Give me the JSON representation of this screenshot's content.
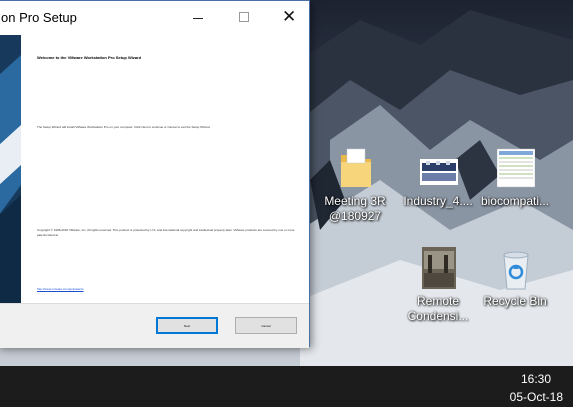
{
  "window": {
    "title": "on Pro Setup",
    "heading": "Welcome to the VMware Workstation Pro Setup Wizard",
    "description": "The Setup Wizard will install VMware Workstation Pro on your computer. Click Next to continue or Cancel to exit the Setup Wizard.",
    "copyright": "Copyright © 1998-2018 VMware, Inc. All rights reserved. This product is protected by U.S. and international copyright and intellectual property laws. VMware products are covered by one or more patents listed at",
    "link": "http://www.vmware.com/go/patents",
    "next_label": "Next",
    "cancel_label": "Cancel",
    "close_glyph": "✕"
  },
  "desktop": {
    "icons": [
      {
        "label": "Meeting 3R @180927",
        "icon": "folder-icon"
      },
      {
        "label": "Industry_4....",
        "icon": "image-thumbnail-icon"
      },
      {
        "label": "biocompati...",
        "icon": "spreadsheet-thumbnail-icon"
      },
      {
        "label": "Remote Condensi...",
        "icon": "photo-thumbnail-icon"
      },
      {
        "label": "Recycle Bin",
        "icon": "recycle-bin-icon"
      }
    ]
  },
  "taskbar": {
    "time": "16:30",
    "date": "05-Oct-18"
  },
  "colors": {
    "accent": "#0078d7",
    "taskbar": "#1c1c1c",
    "banner": "#173a5c"
  }
}
